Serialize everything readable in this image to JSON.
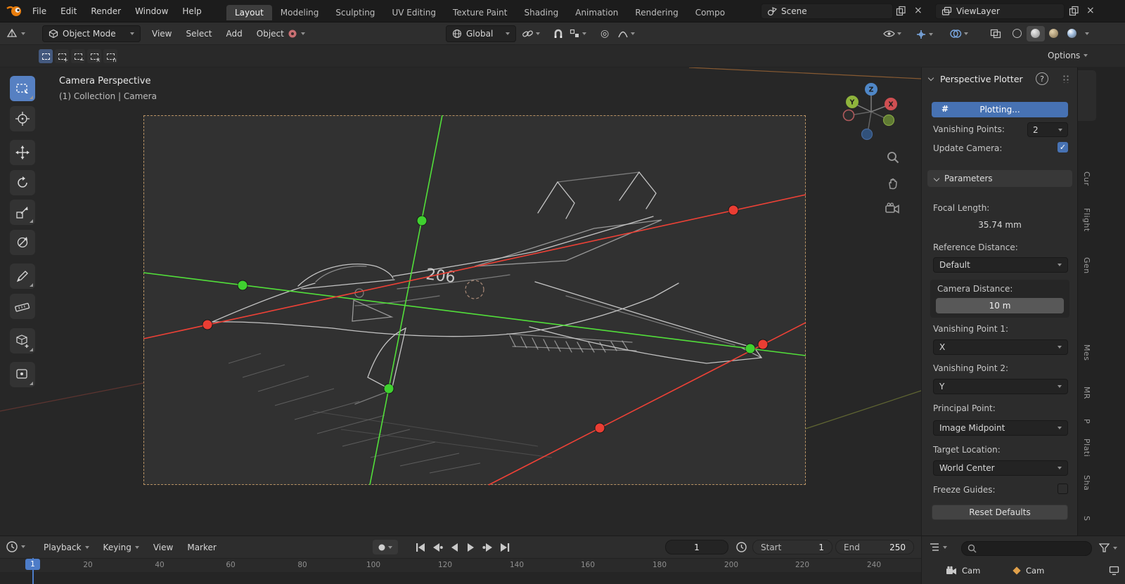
{
  "topbar": {
    "menus": [
      "File",
      "Edit",
      "Render",
      "Window",
      "Help"
    ],
    "workspaces": [
      "Layout",
      "Modeling",
      "Sculpting",
      "UV Editing",
      "Texture Paint",
      "Shading",
      "Animation",
      "Rendering",
      "Compo"
    ],
    "scene": {
      "label": "Scene"
    },
    "viewlayer": {
      "label": "ViewLayer"
    }
  },
  "header": {
    "mode": "Object Mode",
    "menus": [
      "View",
      "Select",
      "Add",
      "Object"
    ],
    "orientation": "Global"
  },
  "toolrow": {
    "options": "Options"
  },
  "viewport": {
    "title": "Camera Perspective",
    "subtitle": "(1) Collection | Camera",
    "marking": "206",
    "axis": {
      "x": "X",
      "y": "Y",
      "z": "Z"
    }
  },
  "plotter": {
    "title": "Perspective Plotter",
    "plotting": "Plotting...",
    "vanishing_points": {
      "label": "Vanishing Points:",
      "value": "2"
    },
    "update_camera": {
      "label": "Update Camera:"
    },
    "parameters": {
      "label": "Parameters"
    },
    "focal_length": {
      "label": "Focal Length:",
      "value": "35.74 mm"
    },
    "reference_distance": {
      "label": "Reference Distance:",
      "value": "Default"
    },
    "camera_distance": {
      "label": "Camera Distance:",
      "value": "10 m"
    },
    "vp1": {
      "label": "Vanishing Point 1:",
      "value": "X"
    },
    "vp2": {
      "label": "Vanishing Point 2:",
      "value": "Y"
    },
    "principal_point": {
      "label": "Principal Point:",
      "value": "Image Midpoint"
    },
    "target_location": {
      "label": "Target Location:",
      "value": "World Center"
    },
    "freeze_guides": {
      "label": "Freeze Guides:"
    },
    "reset": {
      "label": "Reset Defaults"
    }
  },
  "side_tabs": [
    "Cur",
    "Flight",
    "Gen",
    "Mes",
    "MR",
    "P",
    "Plati",
    "Sha",
    "S"
  ],
  "timeline": {
    "menus": [
      "Playback",
      "Keying",
      "View",
      "Marker"
    ],
    "frame": "1",
    "start_label": "Start",
    "start_value": "1",
    "end_label": "End",
    "end_value": "250",
    "playhead": "1",
    "ticks": [
      "20",
      "40",
      "60",
      "80",
      "100",
      "120",
      "140",
      "160",
      "180",
      "200",
      "220",
      "240"
    ]
  },
  "outliner": {
    "items": [
      {
        "label": "Cam"
      },
      {
        "label": "Cam"
      }
    ]
  },
  "icons": {
    "close": "×",
    "check": "✓",
    "help": "?",
    "prop_edit": "◎",
    "plotter_glyph": "#"
  },
  "colors": {
    "accent": "#4772b3",
    "handle_green": "#3fd02f",
    "handle_red": "#ea3d33",
    "camera_frame": "#b99364"
  }
}
